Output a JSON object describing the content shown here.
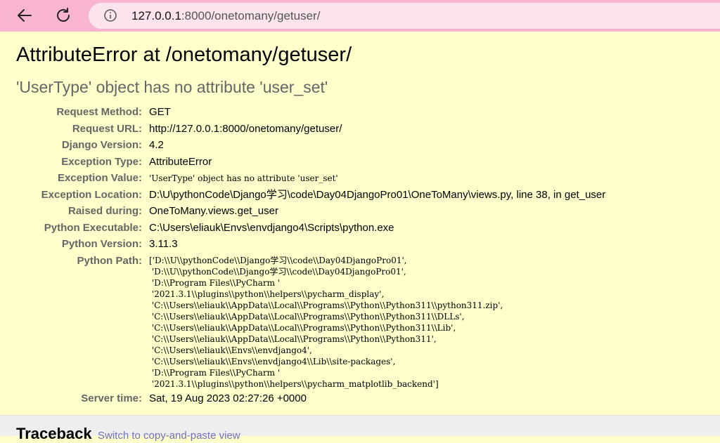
{
  "browser": {
    "url_host": "127.0.0.1",
    "url_rest": ":8000/onetomany/getuser/"
  },
  "error": {
    "title": "AttributeError at /onetomany/getuser/",
    "message": "'UserType' object has no attribute 'user_set'"
  },
  "meta": [
    {
      "key": "Request Method:",
      "value": "GET"
    },
    {
      "key": "Request URL:",
      "value": "http://127.0.0.1:8000/onetomany/getuser/"
    },
    {
      "key": "Django Version:",
      "value": "4.2"
    },
    {
      "key": "Exception Type:",
      "value": "AttributeError"
    },
    {
      "key": "Exception Value:",
      "value": "'UserType' object has no attribute 'user_set'"
    },
    {
      "key": "Exception Location:",
      "value": "D:\\U\\pythonCode\\Django学习\\code\\Day04DjangoPro01\\OneToMany\\views.py, line 38, in get_user"
    },
    {
      "key": "Raised during:",
      "value": "OneToMany.views.get_user"
    },
    {
      "key": "Python Executable:",
      "value": "C:\\Users\\eliauk\\Envs\\envdjango4\\Scripts\\python.exe"
    },
    {
      "key": "Python Version:",
      "value": "3.11.3"
    },
    {
      "key": "Python Path:",
      "value": "['D:\\\\U\\\\pythonCode\\\\Django学习\\\\code\\\\Day04DjangoPro01',\n 'D:\\\\U\\\\pythonCode\\\\Django学习\\\\code\\\\Day04DjangoPro01',\n 'D:\\\\Program Files\\\\PyCharm '\n '2021.3.1\\\\plugins\\\\python\\\\helpers\\\\pycharm_display',\n 'C:\\\\Users\\\\eliauk\\\\AppData\\\\Local\\\\Programs\\\\Python\\\\Python311\\\\python311.zip',\n 'C:\\\\Users\\\\eliauk\\\\AppData\\\\Local\\\\Programs\\\\Python\\\\Python311\\\\DLLs',\n 'C:\\\\Users\\\\eliauk\\\\AppData\\\\Local\\\\Programs\\\\Python\\\\Python311\\\\Lib',\n 'C:\\\\Users\\\\eliauk\\\\AppData\\\\Local\\\\Programs\\\\Python\\\\Python311',\n 'C:\\\\Users\\\\eliauk\\\\Envs\\\\envdjango4',\n 'C:\\\\Users\\\\eliauk\\\\Envs\\\\envdjango4\\\\Lib\\\\site-packages',\n 'D:\\\\Program Files\\\\PyCharm '\n '2021.3.1\\\\plugins\\\\python\\\\helpers\\\\pycharm_matplotlib_backend']"
    },
    {
      "key": "Server time:",
      "value": "Sat, 19 Aug 2023 02:27:26 +0000"
    }
  ],
  "traceback": {
    "title": "Traceback",
    "switch_link": "Switch to copy-and-paste view"
  },
  "colors": {
    "browser_bar": "#f8b4d0",
    "summary_bg": "#ffffcc",
    "label": "#666666"
  },
  "icons": [
    "back-arrow-icon",
    "reload-icon",
    "info-icon"
  ]
}
